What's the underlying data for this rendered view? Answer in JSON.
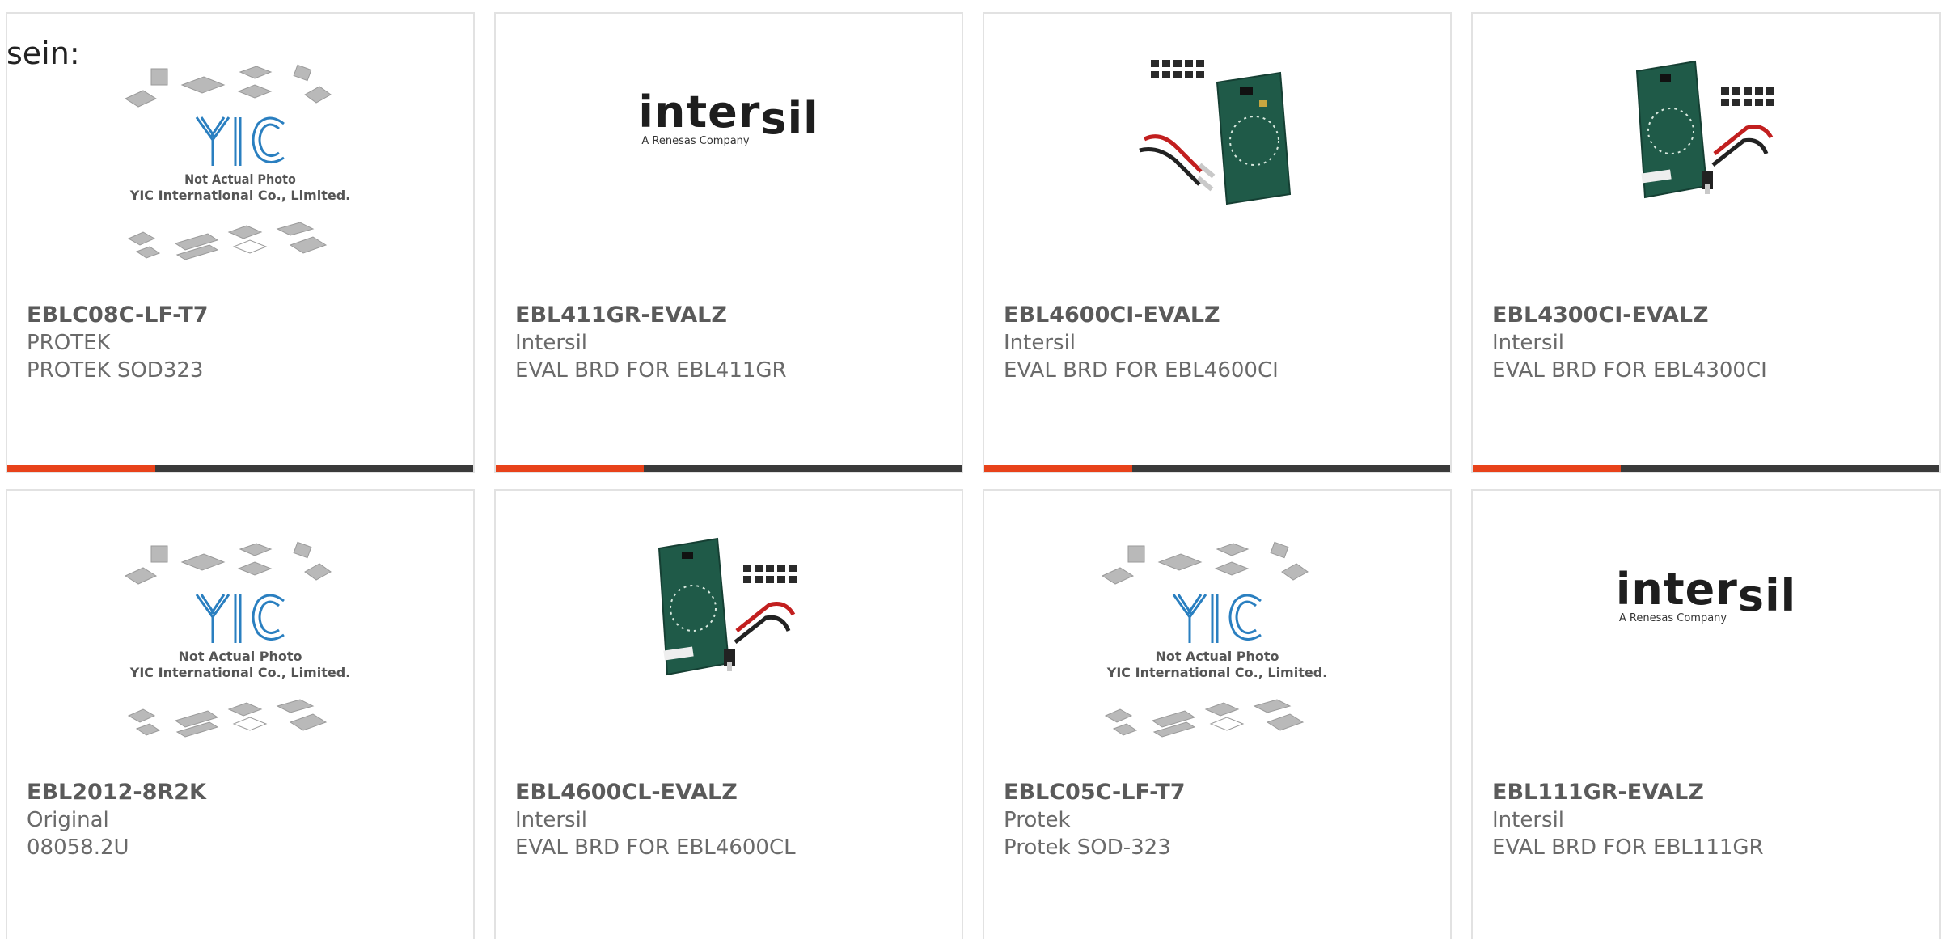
{
  "intro_text": "sein:",
  "colors": {
    "accent": "#e8421a",
    "bar_dark": "#3a3a3a",
    "yic_blue": "#2a7fc0"
  },
  "products": [
    {
      "part": "EBLC08C-LF-T7",
      "brand": "PROTEK",
      "desc": "PROTEK SOD323",
      "image": "yic-placeholder",
      "placeholder_line1": "Not Actual Photo",
      "placeholder_line2": "YIC International Co., Limited."
    },
    {
      "part": "EBL411GR-EVALZ",
      "brand": "Intersil",
      "desc": "EVAL BRD FOR EBL411GR",
      "image": "intersil-logo",
      "logo_word_a": "inter",
      "logo_word_b": "sil",
      "logo_sub": "A Renesas Company"
    },
    {
      "part": "EBL4600CI-EVALZ",
      "brand": "Intersil",
      "desc": "EVAL BRD FOR EBL4600CI",
      "image": "eval-board-a"
    },
    {
      "part": "EBL4300CI-EVALZ",
      "brand": "Intersil",
      "desc": "EVAL BRD FOR EBL4300CI",
      "image": "eval-board-b"
    },
    {
      "part": "EBL2012-8R2K",
      "brand": "Original",
      "desc": "08058.2U",
      "image": "yic-placeholder",
      "placeholder_line1": "Not Actual Photo",
      "placeholder_line2": "YIC International Co., Limited."
    },
    {
      "part": "EBL4600CL-EVALZ",
      "brand": "Intersil",
      "desc": "EVAL BRD FOR EBL4600CL",
      "image": "eval-board-b"
    },
    {
      "part": "EBLC05C-LF-T7",
      "brand": "Protek",
      "desc": "Protek SOD-323",
      "image": "yic-placeholder",
      "placeholder_line1": "Not Actual Photo",
      "placeholder_line2": "YIC International Co., Limited."
    },
    {
      "part": "EBL111GR-EVALZ",
      "brand": "Intersil",
      "desc": "EVAL BRD FOR EBL111GR",
      "image": "intersil-logo",
      "logo_word_a": "inter",
      "logo_word_b": "sil",
      "logo_sub": "A Renesas Company"
    }
  ]
}
